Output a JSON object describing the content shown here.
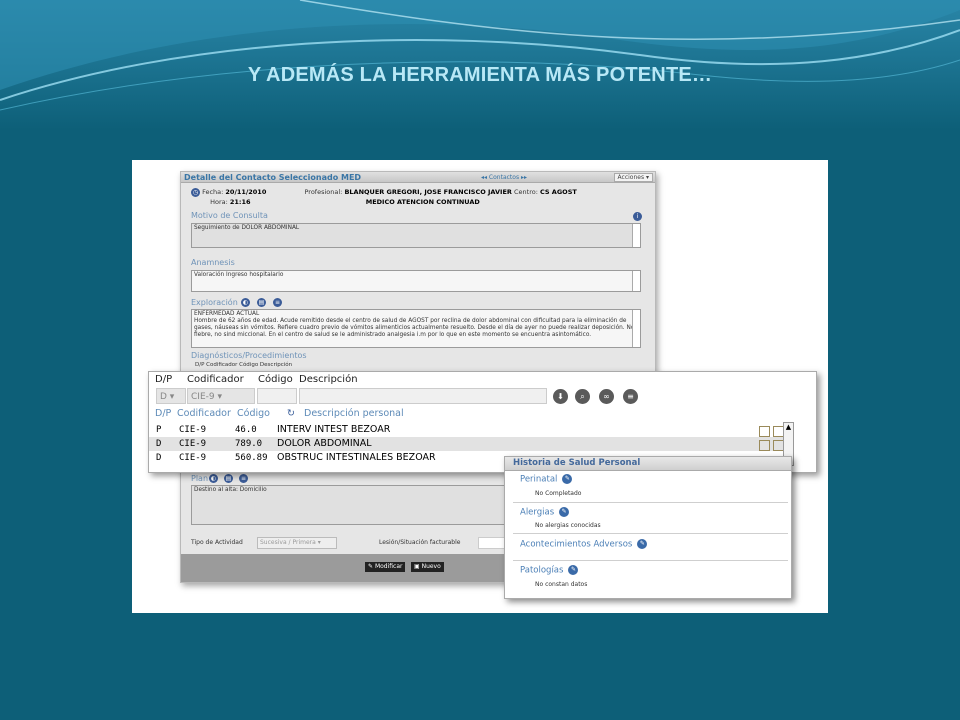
{
  "slide": {
    "title": "Y ADEMÁS LA HERRAMIENTA MÁS POTENTE…",
    "colors": {
      "background": "#0d5f78",
      "title": "#b8e8f6",
      "accent": "#3a76a6"
    }
  },
  "contact_window": {
    "title": "Detalle del Contacto Seleccionado MED",
    "nav_label": "◂◂ Contactos ▸▸",
    "actions_label": "Acciones ▾",
    "fecha_label": "Fecha:",
    "fecha_value": "20/11/2010",
    "hora_label": "Hora:",
    "hora_value": "21:16",
    "profesional_label": "Profesional:",
    "profesional_value": "BLANQUER GREGORI, JOSE FRANCISCO JAVIER",
    "centro_label": "Centro:",
    "centro_value": "CS AGOST",
    "servicio_value": "MEDICO ATENCION CONTINUAD",
    "motivo_label": "Motivo de Consulta",
    "motivo_value": "Seguimiento de DOLOR ABDOMINAL",
    "anamnesis_label": "Anamnesis",
    "anamnesis_value": "Valoración Ingreso hospitalario",
    "exploracion_label": "Exploración",
    "exploracion_heading": "ENFERMEDAD ACTUAL",
    "exploracion_text": "Hombre de 62 años de edad. Acude remitido desde el centro de salud de AGOST por reclina de dolor abdominal con dificultad para la eliminación de gases, náuseas sin vómitos. Refiere cuadro previo de vómitos alimenticios actualmente resuelto. Desde el día de ayer no puede realizar deposición. No fiebre, no sind miccional. En el centro de salud se le administrado analgesia i.m por lo que en este momento se encuentra asintomático.",
    "diagnosticos_label": "Diagnósticos/Procedimientos",
    "diag_mini_header": "D/P   Codificador   Código  Descripción",
    "plan_label": "Plan",
    "plan_value": "Destino al alta: Domicilio",
    "tipo_actividad_label": "Tipo de Actividad",
    "tipo_actividad_value": "Sucesiva / Primera",
    "lesion_label": "Lesión/Situación facturable",
    "modificar_label": "Modificar",
    "nuevo_label": "Nuevo"
  },
  "diagnosis_window": {
    "header": {
      "dp": "D/P",
      "codificador": "Codificador",
      "codigo": "Código",
      "descripcion": "Descripción"
    },
    "input_dp": "D",
    "input_codificador": "CIE-9",
    "columns": {
      "dp": "D/P",
      "codificador": "Codificador",
      "codigo": "Código",
      "descripcion": "Descripción personal"
    },
    "rows": [
      {
        "dp": "P",
        "codificador": "CIE-9",
        "codigo": "46.0",
        "descripcion": "INTERV INTEST BEZOAR"
      },
      {
        "dp": "D",
        "codificador": "CIE-9",
        "codigo": "789.0",
        "descripcion": "DOLOR ABDOMINAL"
      },
      {
        "dp": "D",
        "codificador": "CIE-9",
        "codigo": "560.89",
        "descripcion": "OBSTRUC INTESTINALES BEZOAR"
      }
    ]
  },
  "hsp_window": {
    "title": "Historia de Salud Personal",
    "sections": [
      {
        "label": "Perinatal",
        "value": "No Completado"
      },
      {
        "label": "Alergias",
        "value": "No alergias conocidas"
      },
      {
        "label": "Acontecimientos Adversos",
        "value": ""
      },
      {
        "label": "Patologías",
        "value": "No constan datos"
      }
    ]
  }
}
